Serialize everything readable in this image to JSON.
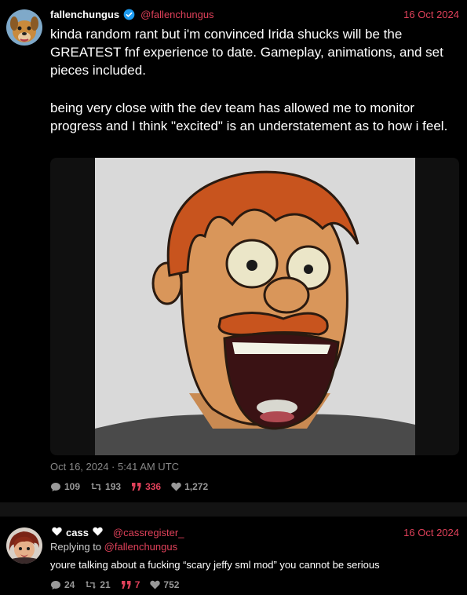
{
  "main_tweet": {
    "display_name": "fallenchungus",
    "handle": "@fallenchungus",
    "date": "16 Oct 2024",
    "text_p1": "kinda random rant but i'm convinced Irida shucks will be the GREATEST fnf experience to date. Gameplay, animations, and set pieces included.",
    "text_p2": "being very close with the dev team has allowed me to monitor progress and I think \"excited\" is an understatement as to how i feel.",
    "timestamp": "Oct 16, 2024 · 5:41 AM UTC",
    "stats": {
      "replies": "109",
      "retweets": "193",
      "quotes": "336",
      "likes": "1,272"
    }
  },
  "reply_tweet": {
    "display_name": "cass",
    "handle": "@cassregister_",
    "date": "16 Oct 2024",
    "replying_prefix": "Replying to",
    "replying_to": "@fallenchungus",
    "text": "youre talking about a fucking “scary jeffy sml mod” you cannot be serious",
    "stats": {
      "replies": "24",
      "retweets": "21",
      "quotes": "7",
      "likes": "752"
    }
  },
  "colors": {
    "accent": "#e0415a",
    "background": "#000000",
    "verified": "#1d9bf0"
  },
  "icons": [
    "verified-badge-icon",
    "reply-bubble-icon",
    "retweet-icon",
    "quote-icon",
    "heart-icon"
  ]
}
